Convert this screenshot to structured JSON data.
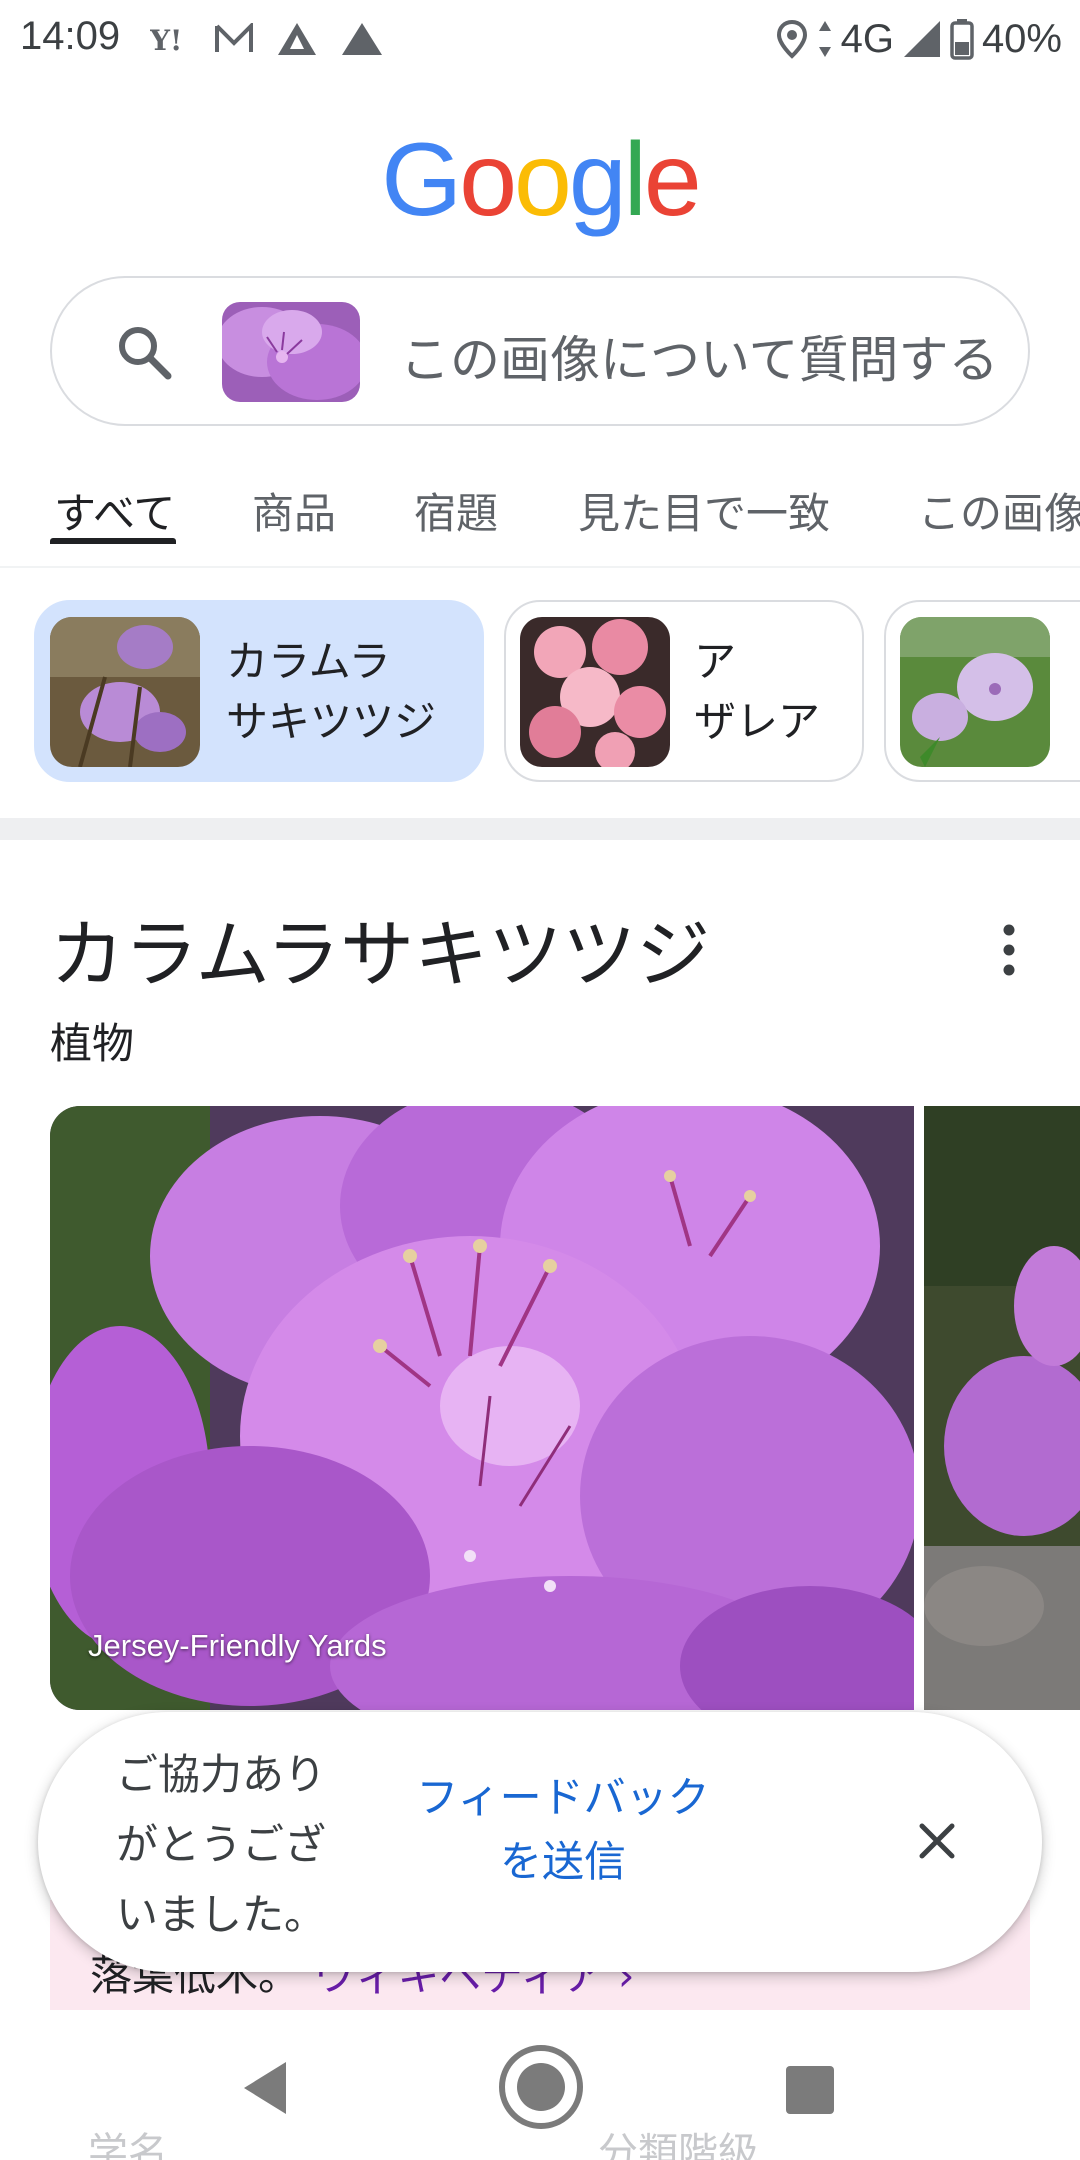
{
  "status_bar": {
    "time": "14:09",
    "network": "4G",
    "battery": "40%"
  },
  "logo": {
    "text": "Google"
  },
  "search": {
    "placeholder": "この画像について質問する"
  },
  "tabs": [
    {
      "label": "すべて",
      "active": true
    },
    {
      "label": "商品",
      "active": false
    },
    {
      "label": "宿題",
      "active": false
    },
    {
      "label": "見た目で一致",
      "active": false
    },
    {
      "label": "この画像",
      "active": false
    }
  ],
  "chips": [
    {
      "line1": "カラムラ",
      "line2": "サキツツジ",
      "selected": true
    },
    {
      "line1": "ア",
      "line2": "ザレア",
      "selected": false
    }
  ],
  "knowledge_panel": {
    "title": "カラムラサキツツジ",
    "subtitle": "植物",
    "image_caption": "Jersey-Friendly Yards",
    "description": "落葉低木。",
    "wiki_link": "ウィキペディア ›"
  },
  "snackbar": {
    "message": "ご協力ありがとうございました。",
    "action": "フィードバックを送信"
  },
  "bottom_labels": {
    "left": "学名",
    "right": "分類階級"
  },
  "colors": {
    "accent": "#1967d2",
    "selected_chip": "#d3e3fd",
    "logo_blue": "#4285f4",
    "logo_red": "#ea4335",
    "logo_yellow": "#fbbc05",
    "logo_green": "#34a853"
  },
  "icons": [
    "location-icon",
    "signal-icon",
    "battery-icon",
    "search-icon",
    "more-vert-icon",
    "close-icon",
    "back-icon",
    "home-icon",
    "recents-icon"
  ]
}
